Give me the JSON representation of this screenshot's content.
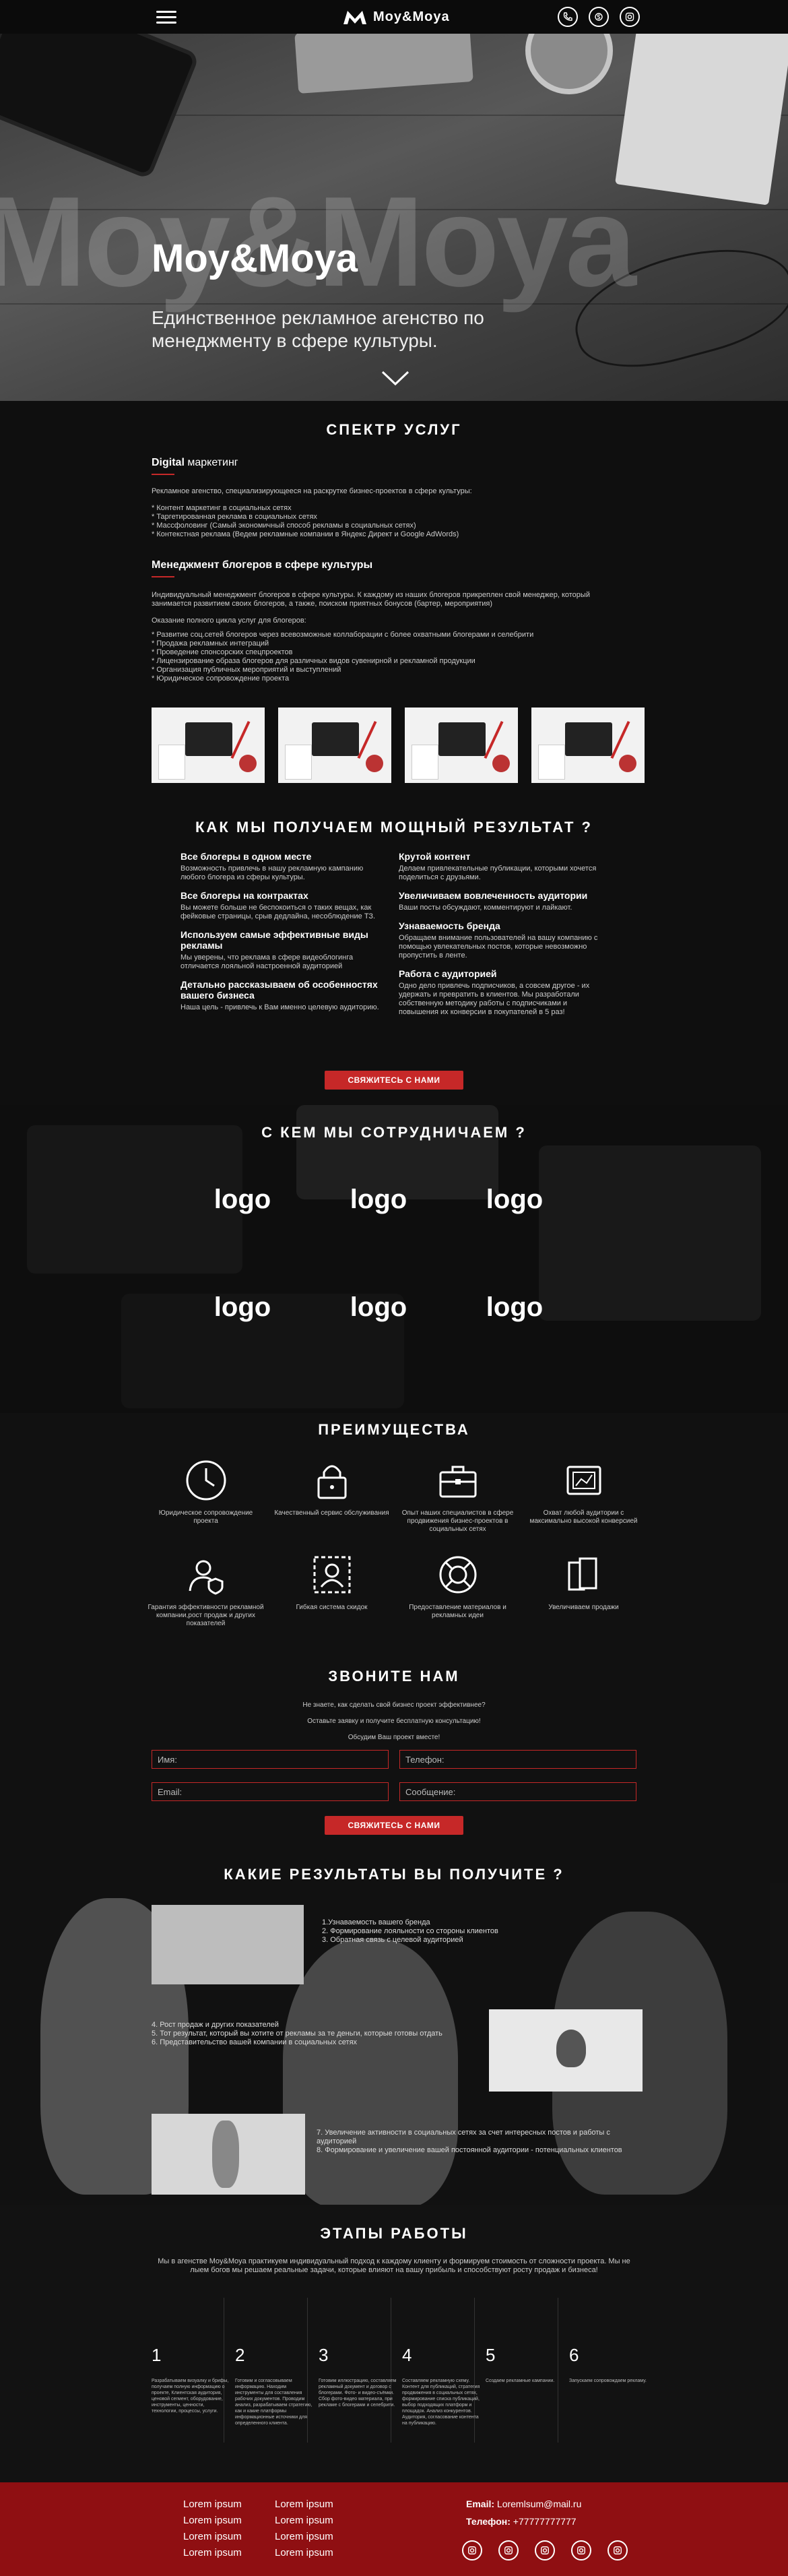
{
  "header": {
    "brand": "Moy&Moya",
    "menu_icon": "hamburger-icon",
    "social_icons": [
      "phone-icon",
      "skype-icon",
      "instagram-icon"
    ]
  },
  "hero": {
    "watermark": "Moy&Moya",
    "title": "Moy&Moya",
    "subtitle": "Единственное рекламное агенство по менеджменту в сфере культуры.",
    "scroll_icon": "chevron-down-icon"
  },
  "services": {
    "title": "СПЕКТР УСЛУГ",
    "digital": {
      "title_bold": "Digital",
      "title_rest": " маркетинг",
      "intro": "Рекламное агенство, специализирующееся на раскрутке бизнес-проектов в сфере культуры:",
      "items": [
        "* Контент маркетинг в социальных сетях",
        "* Таргетированная реклама в социальных сетях",
        "* Массфоловинг (Самый экономичный способ рекламы в социальных сетях)",
        "* Контекстная реклама (Ведем рекламные компании в Яндекс Директ и Google AdWords)"
      ]
    },
    "bloggers": {
      "title": "Менеджмент блогеров в сфере культуры",
      "intro": "Индивидуальный менеджмент блогеров в сфере культуры. К каждому из наших блогеров прикреплен свой менеджер, который занимается развитием своих блогеров, а также, поиском приятных бонусов (бартер, мероприятия)",
      "intro2": "Оказание полного цикла услуг для блогеров:",
      "items": [
        "* Развитие соц.сетей блогеров через всевозможные коллаборации с более охватными блогерами и селебрити",
        "* Продажа рекламных интеграций",
        "* Проведение спонсорских спецпроектов",
        "* Лицензирование образа блогеров для различных видов сувенирной и рекламной продукции",
        "* Организация публичных мероприятий и выступлений",
        "* Юридическое сопровождение проекта"
      ]
    }
  },
  "how": {
    "title": "КАК МЫ ПОЛУЧАЕМ МОЩНЫЙ РЕЗУЛЬТАТ ?",
    "left": [
      {
        "h": "Все блогеры в одном месте",
        "p": "Возможность привлечь в нашу рекламную кампанию любого блогера из сферы культуры."
      },
      {
        "h": "Все блогеры на контрактах",
        "p": "Вы можете больше не беспокоиться о таких вещах, как фейковые страницы, срыв дедлайна, несоблюдение ТЗ."
      },
      {
        "h": "Используем самые эффективные виды рекламы",
        "p": "Мы уверены, что реклама в сфере видеоблогинга отличается лояльной настроенной аудиторией"
      },
      {
        "h": "Детально рассказываем об особенностях вашего бизнеса",
        "p": "Наша цель - привлечь к Вам именно целевую аудиторию."
      }
    ],
    "right": [
      {
        "h": "Крутой контент",
        "p": "Делаем привлекательные публикации, которыми хочется поделиться с друзьями."
      },
      {
        "h": "Увеличиваем вовлеченность аудитории",
        "p": "Ваши посты обсуждают, комментируют и лайкают."
      },
      {
        "h": "Узнаваемость бренда",
        "p": "Обращаем внимание пользователей на вашу компанию с помощью увлекательных постов, которые невозможно пропустить в ленте."
      },
      {
        "h": "Работа с аудиторией",
        "p": "Одно дело привлечь подписчиков, а совсем другое - их удержать и превратить в клиентов. Мы разработали собственную методику работы с подписчиками и повышения их конверсии в покупателей в 5 раз!"
      }
    ],
    "cta": "СВЯЖИТЕСЬ С НАМИ"
  },
  "partners": {
    "title": "С КЕМ МЫ СОТРУДНИЧАЕМ ?",
    "logos": [
      "logo",
      "logo",
      "logo",
      "logo",
      "logo",
      "logo"
    ]
  },
  "advantages": {
    "title": "ПРЕИМУЩЕСТВА",
    "items": [
      {
        "icon": "clock-icon",
        "text": "Юридическое сопровождение проекта"
      },
      {
        "icon": "lock-icon",
        "text": "Качественный сервис обслуживания"
      },
      {
        "icon": "briefcase-icon",
        "text": "Опыт наших специалистов в сфере продвижения бизнес-проектов в социальных сетях"
      },
      {
        "icon": "tablet-icon",
        "text": "Охват любой аудитории с максимально высокой конверсией"
      },
      {
        "icon": "user-shield-icon",
        "text": "Гарантия эффективности рекламной компании,рост продаж и других показателей"
      },
      {
        "icon": "user-frame-icon",
        "text": "Гибкая система скидок"
      },
      {
        "icon": "lifebuoy-icon",
        "text": "Предоставление материалов и рекламных идеи"
      },
      {
        "icon": "layers-icon",
        "text": "Увеличиваем продажи"
      }
    ]
  },
  "call": {
    "title": "ЗВОНИТЕ НАМ",
    "line1": "Не знаете, как сделать свой бизнес проект эффективнее?",
    "line2": "Оставьте заявку и получите бесплатную консультацию!",
    "line3": "Обсудим Ваш проект вместе!",
    "name_placeholder": "Имя:",
    "phone_placeholder": "Телефон:",
    "email_placeholder": "Email:",
    "message_placeholder": "Сообщение:",
    "cta": "СВЯЖИТЕСЬ С НАМИ"
  },
  "results": {
    "title": "КАКИЕ РЕЗУЛЬТАТЫ ВЫ ПОЛУЧИТЕ ?",
    "group1": [
      "1.Узнаваемость вашего бренда",
      "2. Формирование лояльности со стороны клиентов",
      "3. Обратная связь с целевой аудиторией"
    ],
    "group2": [
      "4. Рост продаж и других показателей",
      "5. Тот результат, который вы хотите от рекламы за те деньги, которые готовы отдать",
      "6. Представительство вашей компании в социальных сетях"
    ],
    "group3": [
      "7. Увеличение активности в социальных сетях за счет интересных постов и работы с аудиторией",
      "8. Формирование и увеличение вашей постоянной аудитории - потенциальных клиентов"
    ]
  },
  "stages": {
    "title": "ЭТАПЫ РАБОТЫ",
    "intro": "Мы в агенстве Moy&Moya практикуем индивидуальный подход к каждому клиенту и формируем стоимость от сложности проекта. Мы не лыем богов мы решаем реальные задачи, которые влияют на вашу прибыль и способствуют росту продаж и бизнеса!",
    "items": [
      {
        "num": "1",
        "text": "Разрабатываем визуалку и брифы, получаем полную информацию о проекте, Клиентская аудитория, ценовой сегмент, оборудование, инструменты, ценности, технологии, процессы, услуги."
      },
      {
        "num": "2",
        "text": "Готовим и согласовываем информацию. Находим инструменты для составления рабочих документов. Проводим анализ, разрабатываем стратегию, как и какие платформы информационные источники для определенного клиента."
      },
      {
        "num": "3",
        "text": "Готовим иллюстрацию, составляем рекламный документ и договор с блогерами. Фото- и видео-съёмки. Сбор фото-видео материала, при рекламе с блогерами и селебрити."
      },
      {
        "num": "4",
        "text": "Составляем рекламную схему. Контент для публикаций, стратегия продвижения в социальных сетях, формирование списка публикаций, выбор подходящих платформ и площадок. Анализ конкурентов. Аудитория, согласование контента на публикацию."
      },
      {
        "num": "5",
        "text": "Создаем рекламные кампании."
      },
      {
        "num": "6",
        "text": "Запускаем сопровождаем рекламу."
      }
    ]
  },
  "footer": {
    "links_col1": [
      "Lorem ipsum",
      "Lorem ipsum",
      "Lorem ipsum",
      "Lorem ipsum"
    ],
    "links_col2": [
      "Lorem ipsum",
      "Lorem ipsum",
      "Lorem ipsum",
      "Lorem ipsum"
    ],
    "email_label": "Email:",
    "email": "Loremlsum@mail.ru",
    "phone_label": "Телефон:",
    "phone": "+77777777777",
    "social_icons": [
      "instagram-icon",
      "instagram-icon",
      "instagram-icon",
      "instagram-icon",
      "instagram-icon"
    ]
  },
  "colors": {
    "accent": "#c62828",
    "footer": "#8f0f12",
    "background": "#0f0f0f"
  }
}
